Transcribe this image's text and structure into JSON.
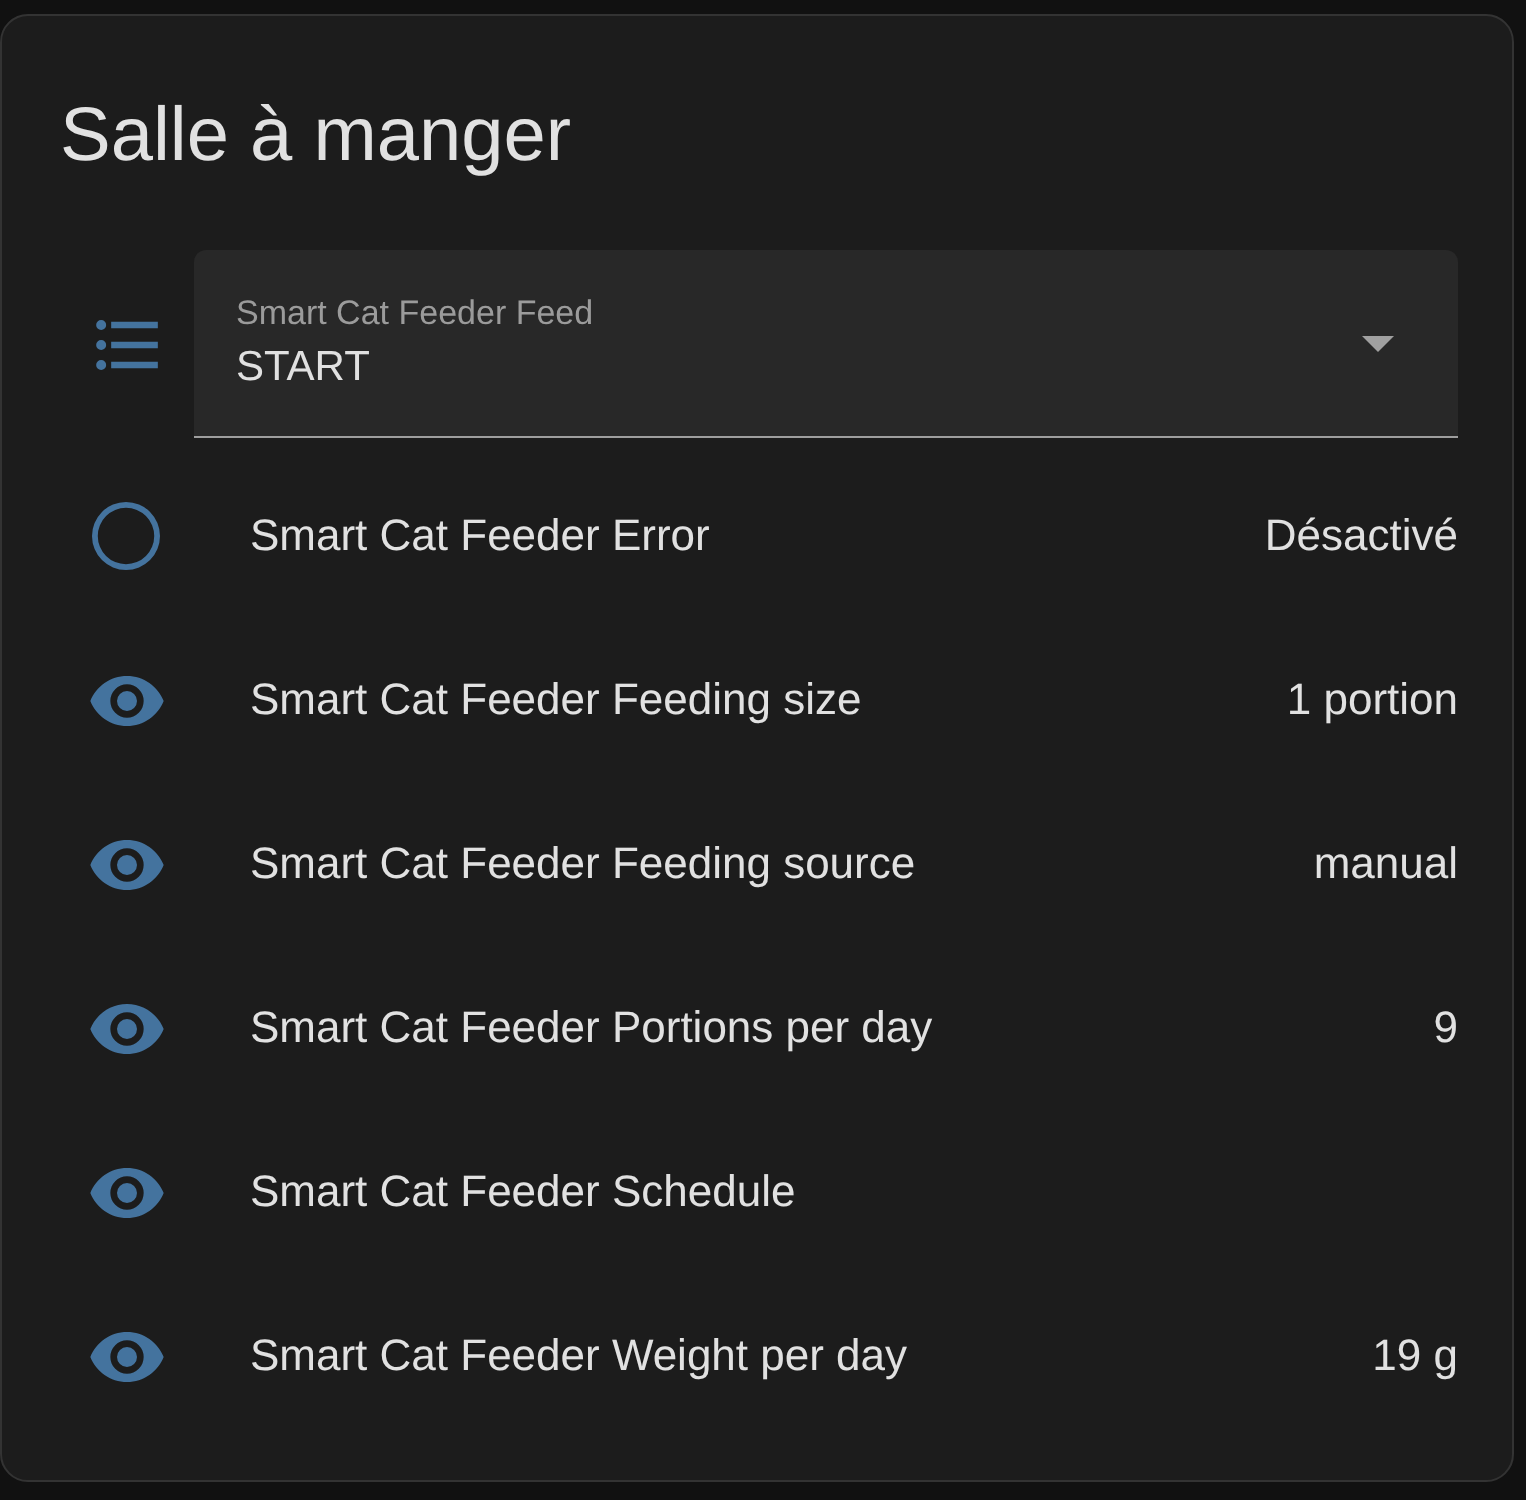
{
  "card": {
    "title": "Salle à manger"
  },
  "select": {
    "label": "Smart Cat Feeder Feed",
    "value": "START"
  },
  "entities": [
    {
      "kind": "binary_sensor",
      "name": "Smart Cat Feeder Error",
      "state": "Désactivé"
    },
    {
      "kind": "sensor",
      "name": "Smart Cat Feeder Feeding size",
      "state": "1 portion"
    },
    {
      "kind": "sensor",
      "name": "Smart Cat Feeder Feeding source",
      "state": "manual"
    },
    {
      "kind": "sensor",
      "name": "Smart Cat Feeder Portions per day",
      "state": "9"
    },
    {
      "kind": "sensor",
      "name": "Smart Cat Feeder Schedule"
    },
    {
      "kind": "sensor",
      "name": "Smart Cat Feeder Weight per day",
      "state": "19 g"
    }
  ]
}
